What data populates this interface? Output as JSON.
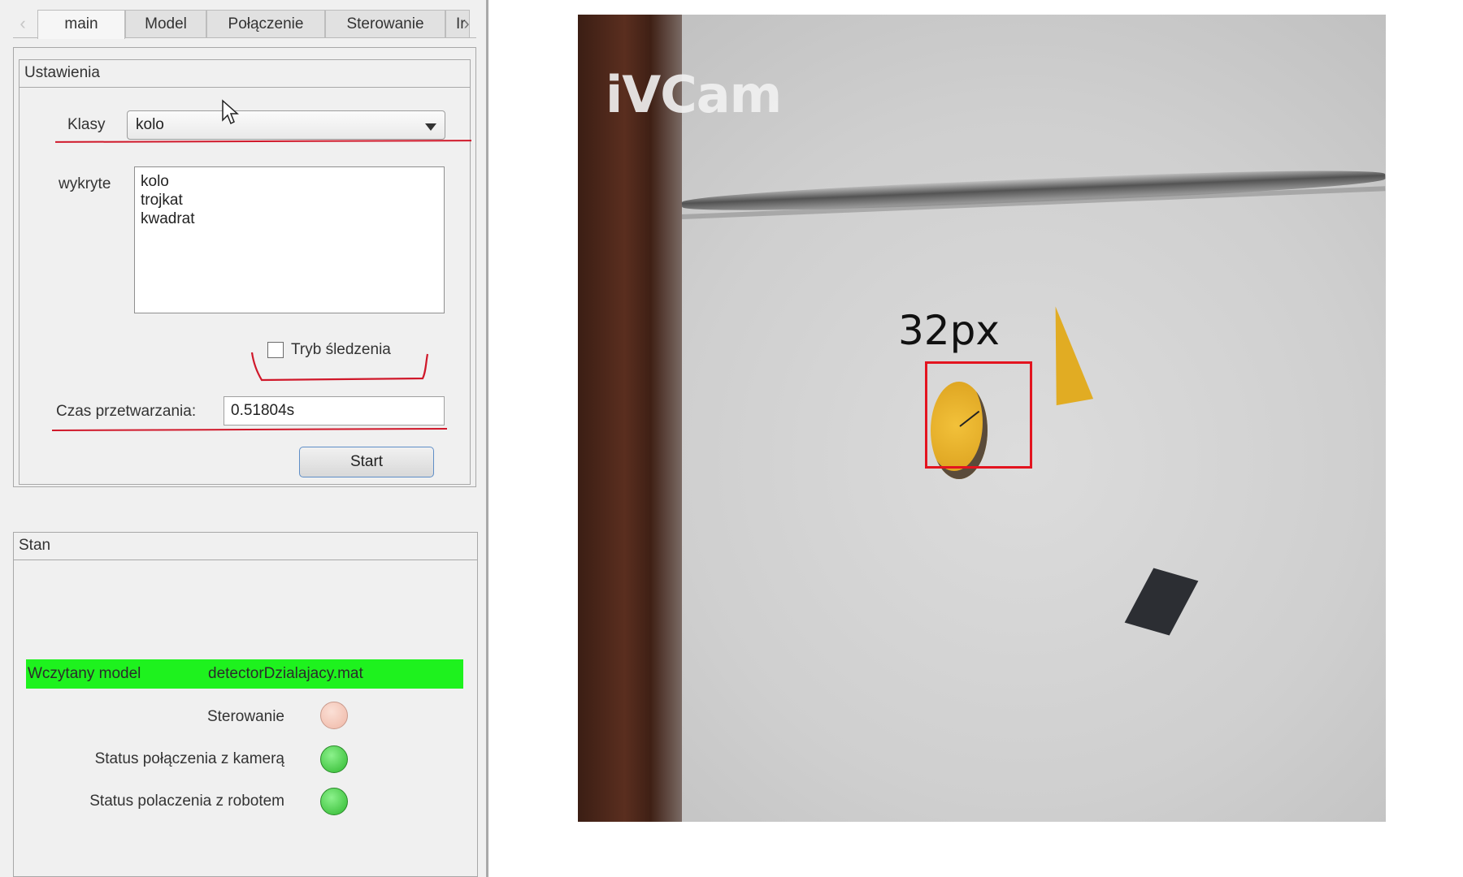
{
  "tabs": [
    {
      "label": "main",
      "active": true
    },
    {
      "label": "Model",
      "active": false
    },
    {
      "label": "Połączenie",
      "active": false
    },
    {
      "label": "Sterowanie",
      "active": false
    },
    {
      "label": "Ir",
      "active": false
    }
  ],
  "settings": {
    "title": "Ustawienia",
    "classes_label": "Klasy",
    "classes_selected": "kolo",
    "detected_label": "wykryte",
    "detected_items": [
      "kolo",
      "trojkat",
      "kwadrat"
    ],
    "tracking_label": "Tryb śledzenia",
    "tracking_checked": false,
    "processing_time_label": "Czas przetwarzania:",
    "processing_time_value": "0.51804s",
    "start_label": "Start"
  },
  "status": {
    "title": "Stan",
    "model_label": "Wczytany model",
    "model_value": "detectorDzialajacy.mat",
    "model_bar_color": "#1ef21e",
    "indicators": [
      {
        "label": "Sterowanie",
        "state": "off",
        "color": "#efb7a6"
      },
      {
        "label": "Status połączenia z kamerą",
        "state": "on",
        "color": "#2fb82f"
      },
      {
        "label": "Status polaczenia z robotem",
        "state": "on",
        "color": "#2fb82f"
      }
    ]
  },
  "camera": {
    "watermark": "iVCam",
    "detection_label": "32px",
    "detection_color": "#e3141f"
  },
  "annotation_color": "#d0182a"
}
